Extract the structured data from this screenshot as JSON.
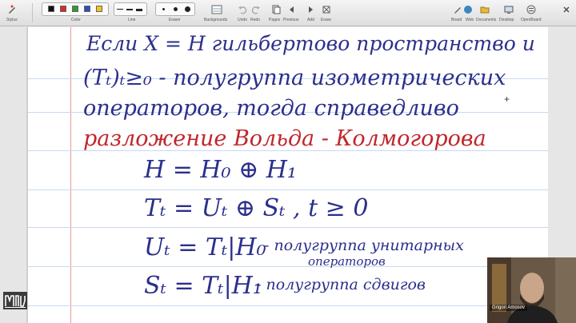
{
  "toolbar": {
    "stylus_label": "Stylus",
    "color_label": "Color",
    "line_label": "Line",
    "eraser_label": "Eraser",
    "backgrounds_label": "Backgrounds",
    "undo_label": "Undo",
    "redo_label": "Redo",
    "pages_label": "Pages",
    "previous_label": "Previous",
    "add_label": "Add",
    "erase_label": "Erase",
    "board_label": "Board",
    "web_label": "Web",
    "documents_label": "Documents",
    "desktop_label": "Desktop",
    "openboard_label": "OpenBoard",
    "colors": [
      "#111111",
      "#d62a2a",
      "#2a9b3a",
      "#2b4fbf",
      "#f2c418"
    ]
  },
  "board": {
    "line1": "Если  X = H  гильбертово пространство и",
    "line2": "(Tₜ)ₜ≥₀ - полугруппа изометрических",
    "line3": "операторов, тогда справедливо",
    "line4": "разложение  Вольда - Колмогорова",
    "eq1": "H = H₀ ⊕ H₁",
    "eq2": "Tₜ = Uₜ ⊕ Sₜ ,  t ≥ 0",
    "eq3": "Uₜ = Tₜ|H₀",
    "eq3_note_a": "- полугруппа унитарных",
    "eq3_note_b": "операторов",
    "eq4": "Sₜ = Tₜ|H₁",
    "eq4_note": "- полугруппа сдвигов",
    "ink_color": "#2b2f8c",
    "highlight_color": "#c0262b"
  },
  "webcam": {
    "participant_name": "Grigori Amosov"
  }
}
